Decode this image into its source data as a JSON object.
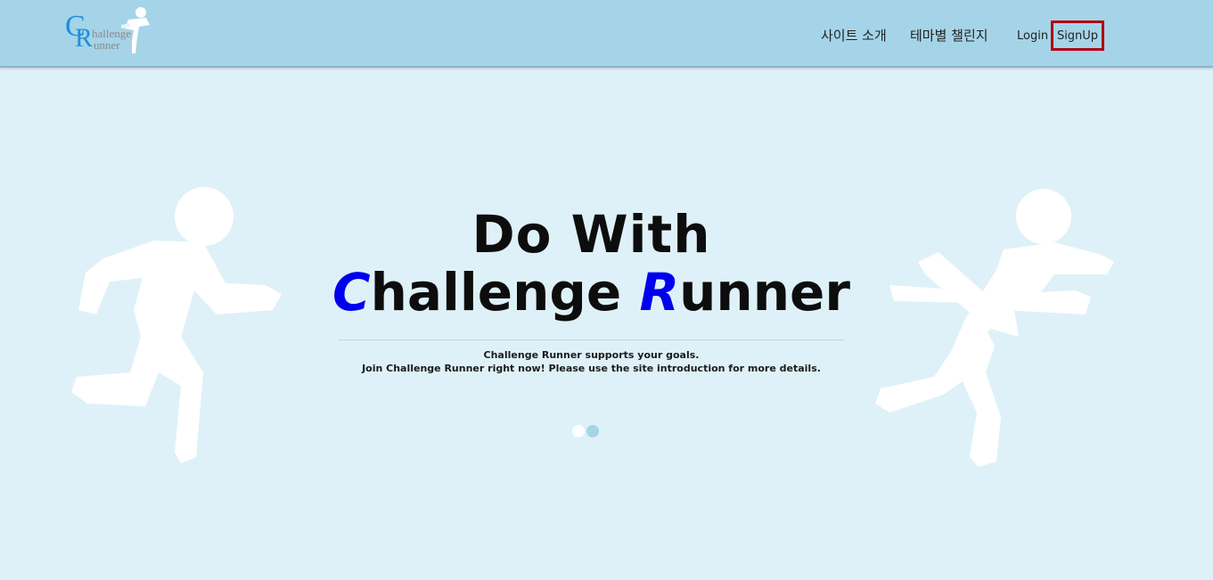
{
  "header": {
    "logo": {
      "big_c": "C",
      "big_r": "R",
      "word1": "hallenge",
      "word2": "unner"
    },
    "nav": {
      "intro": "사이트 소개",
      "theme": "테마별 챌린지",
      "login": "Login",
      "signup": "SignUp"
    }
  },
  "hero": {
    "line1": "Do With",
    "line2_c": "C",
    "line2_mid": "hallenge ",
    "line2_r": "R",
    "line2_end": "unner",
    "subtitle1": "Challenge Runner supports your goals.",
    "subtitle2": "Join Challenge Runner right now! Please use the site introduction for more details."
  },
  "carousel": {
    "dots": [
      "slide-1",
      "slide-2"
    ],
    "active_index": 1
  },
  "colors": {
    "header_bg": "#a5d4e8",
    "page_bg": "#dff1f8",
    "accent": "#0000ee",
    "signup_border": "#b00010"
  },
  "icons": [
    "logo-runner-icon",
    "left-runner-icon",
    "right-finish-runner-icon"
  ]
}
